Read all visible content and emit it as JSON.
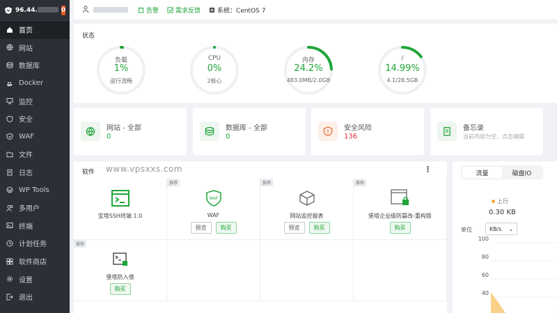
{
  "sidebar": {
    "ip_prefix": "96.44.",
    "ip_suffix": "",
    "badge": "0",
    "items": [
      {
        "label": "首页",
        "icon": "home-icon",
        "active": true
      },
      {
        "label": "网站",
        "icon": "globe-icon"
      },
      {
        "label": "数据库",
        "icon": "database-icon"
      },
      {
        "label": "Docker",
        "icon": "docker-icon"
      },
      {
        "label": "监控",
        "icon": "monitor-icon"
      },
      {
        "label": "安全",
        "icon": "shield-icon"
      },
      {
        "label": "WAF",
        "icon": "waf-icon"
      },
      {
        "label": "文件",
        "icon": "folder-icon"
      },
      {
        "label": "日志",
        "icon": "log-icon"
      },
      {
        "label": "WP Tools",
        "icon": "wordpress-icon"
      },
      {
        "label": "多用户",
        "icon": "users-icon"
      },
      {
        "label": "终端",
        "icon": "terminal-icon"
      },
      {
        "label": "计划任务",
        "icon": "clock-icon"
      },
      {
        "label": "软件商店",
        "icon": "store-icon"
      },
      {
        "label": "设置",
        "icon": "gear-icon"
      },
      {
        "label": "退出",
        "icon": "logout-icon"
      }
    ]
  },
  "topbar": {
    "alert": "告警",
    "feedback": "需求反馈",
    "system": "系统：CentOS 7"
  },
  "status": {
    "title": "状态",
    "gauges": [
      {
        "label": "负载",
        "value": "1%",
        "sub": "运行流畅",
        "percent": 1
      },
      {
        "label": "CPU",
        "value": "0%",
        "sub": "2核心",
        "percent": 0
      },
      {
        "label": "内存",
        "value": "24.2%",
        "sub": "483.0MB/2.0GB",
        "percent": 24.2
      },
      {
        "label": "/",
        "value": "14.99%",
        "sub": "4.1/28.5GB",
        "percent": 14.99
      }
    ]
  },
  "cards": [
    {
      "title": "网站 - 全部",
      "value": "0",
      "icon": "globe-icon"
    },
    {
      "title": "数据库 - 全部",
      "value": "0",
      "icon": "database-icon"
    },
    {
      "title": "安全风险",
      "value": "136",
      "icon": "security-risk-icon"
    },
    {
      "title": "备忘录",
      "value": "当前内容为空，点击编辑",
      "icon": "memo-icon"
    }
  ],
  "software": {
    "title": "软件",
    "watermark": "www.vpsxxs.com",
    "tag": "推荐",
    "preview_label": "预览",
    "buy_label": "购买",
    "items": [
      {
        "name": "宝塔SSH终端 1.0",
        "icon": "terminal-icon"
      },
      {
        "name": "WAF",
        "icon": "waf-icon"
      },
      {
        "name": "网站监控报表",
        "icon": "box-icon"
      },
      {
        "name": "堡塔企业级防篡改-重构版",
        "icon": "lock-window-icon"
      },
      {
        "name": "堡塔防入侵",
        "icon": "intrusion-icon"
      }
    ]
  },
  "traffic": {
    "tab_flow": "流量",
    "tab_disk": "磁盘IO",
    "up_label": "上行",
    "up_value": "0.30 KB",
    "unit_label": "单位",
    "unit_value": "KB/s",
    "y_ticks": [
      "100",
      "80",
      "60",
      "40"
    ]
  }
}
